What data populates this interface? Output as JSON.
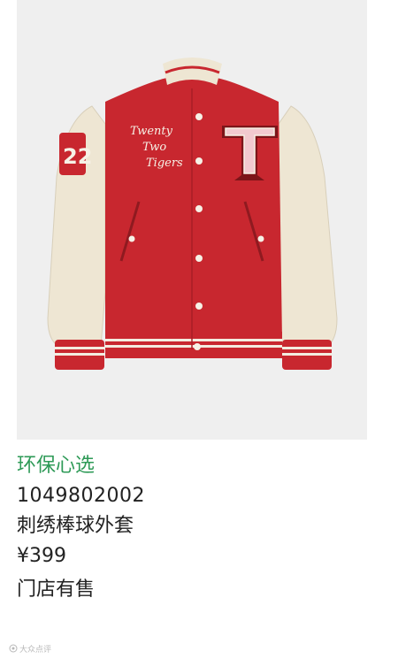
{
  "product": {
    "image_subject": "jacket-icon",
    "image_text": {
      "chest_script": [
        "Twenty",
        "Two",
        "Tigers"
      ],
      "chest_letter": "T",
      "sleeve_number": "22"
    },
    "tag": "环保心选",
    "article_no": "1049802002",
    "name": "刺绣棒球外套",
    "price": "¥399",
    "availability": "门店有售"
  },
  "watermark": {
    "text": "大众点评"
  },
  "colors": {
    "tag_green": "#2e9a57",
    "jacket_red": "#c8272f",
    "sleeve_cream": "#eee6d3"
  }
}
